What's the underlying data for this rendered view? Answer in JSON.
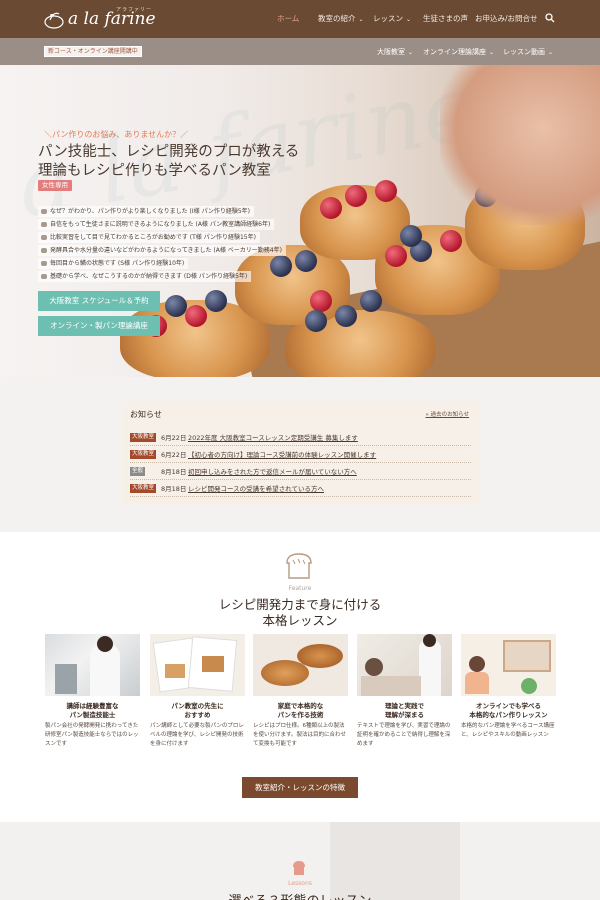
{
  "header": {
    "logo_text": "a la farine",
    "logo_sub": "アラファリーヌ",
    "nav": [
      {
        "label": "ホーム",
        "has_caret": false,
        "active": true
      },
      {
        "label": "教室の紹介",
        "has_caret": true,
        "active": false
      },
      {
        "label": "レッスン",
        "has_caret": true,
        "active": false
      },
      {
        "label": "生徒さまの声",
        "has_caret": false,
        "active": false
      },
      {
        "label": "お申込み/お問合せ",
        "has_caret": false,
        "active": false
      }
    ],
    "search_icon": "search-icon",
    "caret_glyph": "⌄"
  },
  "subbar": {
    "notice": "新コース・オンライン講座開講中",
    "links": [
      {
        "label": "大阪教室"
      },
      {
        "label": "オンライン理論講座"
      },
      {
        "label": "レッスン動画"
      }
    ]
  },
  "hero": {
    "tagline": "＼パン作りのお悩み、ありませんか？／",
    "title_line1": "パン技能士、レシピ開発のプロが教える",
    "title_line2": "理論もレシピ作りも学べるパン教室",
    "badge": "女性専用",
    "testimonials": [
      "なぜ？がわかり、パン作りがより楽しくなりました (I様 パン作り経験5年)",
      "自信をもって生徒さまに説明できるようになりました (A様 パン教室講師経験6年)",
      "比較実習をして目で見てわかるところがお勧めです (T様 パン作り経験15年)",
      "発酵具合や水分量の違いなどがわかるようになってきました (A様 ベーカリー勤務4年)",
      "毎回目から鱗の状態です (S様 パン作り経験10年)",
      "基礎から学べ、なぜこうするのかが納得できます (D様 パン作り経験5年)"
    ],
    "cta_schedule": "大阪教室 スケジュール＆予約",
    "cta_online": "オンライン・製パン理論講座"
  },
  "news": {
    "heading": "お知らせ",
    "past_link": "» 過去のお知らせ",
    "items": [
      {
        "tag": "大阪教室",
        "tag_color": "#a24a2a",
        "date": "6月22日",
        "text": "2022年度 大阪教室コースレッスン定期受講生 募集します"
      },
      {
        "tag": "大阪教室",
        "tag_color": "#a24a2a",
        "date": "6月22日",
        "text": "【初心者の方向け】理論コース受講前の体験レッスン開催します"
      },
      {
        "tag": "全般",
        "tag_color": "#8c8c8c",
        "date": "8月18日",
        "text": "初回申し込みをされた方で返信メールが届いていない方へ"
      },
      {
        "tag": "大阪教室",
        "tag_color": "#a24a2a",
        "date": "8月18日",
        "text": "レシピ開発コースの受講を希望されている方へ"
      }
    ]
  },
  "feature": {
    "label": "Feature",
    "title_line1": "レシピ開発力まで身に付ける",
    "title_line2": "本格レッスン",
    "items": [
      {
        "caption_line1": "講師は経験豊富な",
        "caption_line2": "パン製造技能士",
        "body": "製パン会社の発酵開発に携わってきた研修室パン製造技能士ならではのレッスンです"
      },
      {
        "caption_line1": "パン教室の先生に",
        "caption_line2": "おすすめ",
        "body": "パン講師として必要な製パンのプロレベルの理論を学び、レシピ開発の技術を身に付けます"
      },
      {
        "caption_line1": "家庭で本格的な",
        "caption_line2": "パンを作る技術",
        "body": "レシピはプロ仕様。6種類以上の製法を使い分けます。製法は目的に合わせて変換も可能です"
      },
      {
        "caption_line1": "理論と実践で",
        "caption_line2": "理解が深まる",
        "body": "テキストで理論を学び、実習で理論の証明を確かめることで納得し理解を深めます"
      },
      {
        "caption_line1": "オンラインでも学べる",
        "caption_line2": "本格的なパン作りレッスン",
        "body": "本格的なパン理論を学べるコース講座と、レシピやスキルの動画レッスン"
      }
    ],
    "button": "教室紹介・レッスンの特徴"
  },
  "lessons": {
    "label": "Lessons",
    "title": "選べる３形態のレッスン"
  },
  "colors": {
    "header_bg": "#6a4a33",
    "accent_teal": "#6dbfb1",
    "accent_coral": "#e07b5a",
    "button_brown": "#7b4a2e"
  }
}
